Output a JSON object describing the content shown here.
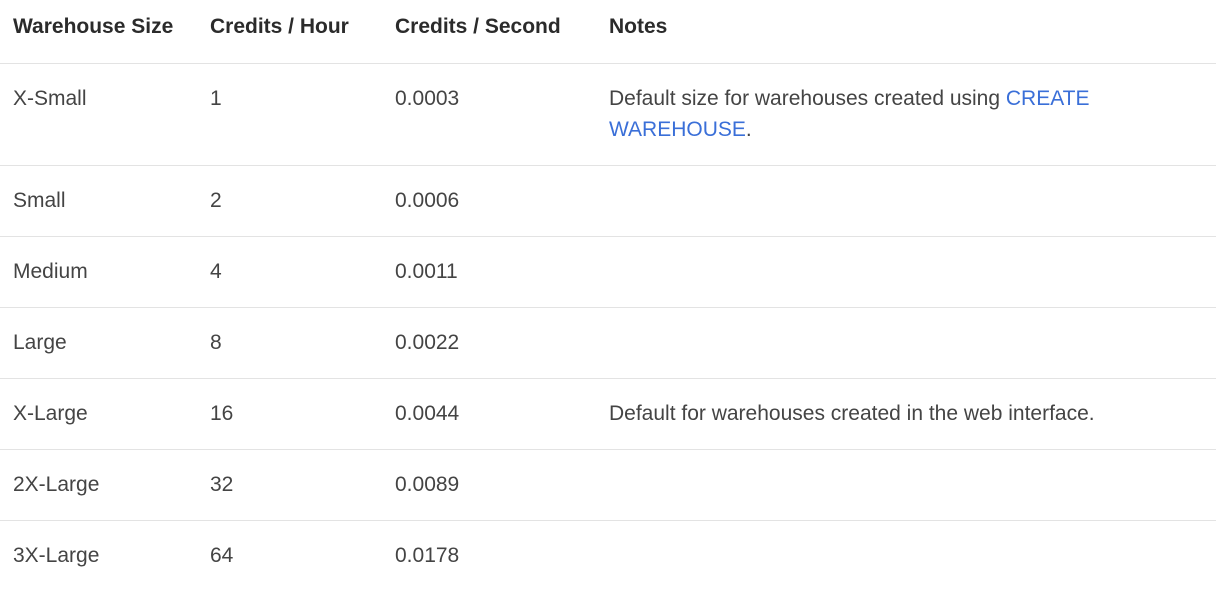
{
  "table": {
    "headers": [
      "Warehouse Size",
      "Credits / Hour",
      "Credits / Second",
      "Notes"
    ],
    "rows": [
      {
        "size": "X-Small",
        "credits_hour": "1",
        "credits_second": "0.0003",
        "notes_before": "Default size for warehouses created using ",
        "notes_link": "CREATE WAREHOUSE",
        "notes_after": "."
      },
      {
        "size": "Small",
        "credits_hour": "2",
        "credits_second": "0.0006",
        "notes": ""
      },
      {
        "size": "Medium",
        "credits_hour": "4",
        "credits_second": "0.0011",
        "notes": ""
      },
      {
        "size": "Large",
        "credits_hour": "8",
        "credits_second": "0.0022",
        "notes": ""
      },
      {
        "size": "X-Large",
        "credits_hour": "16",
        "credits_second": "0.0044",
        "notes": "Default for warehouses created in the web interface."
      },
      {
        "size": "2X-Large",
        "credits_hour": "32",
        "credits_second": "0.0089",
        "notes": ""
      },
      {
        "size": "3X-Large",
        "credits_hour": "64",
        "credits_second": "0.0178",
        "notes": ""
      }
    ]
  }
}
